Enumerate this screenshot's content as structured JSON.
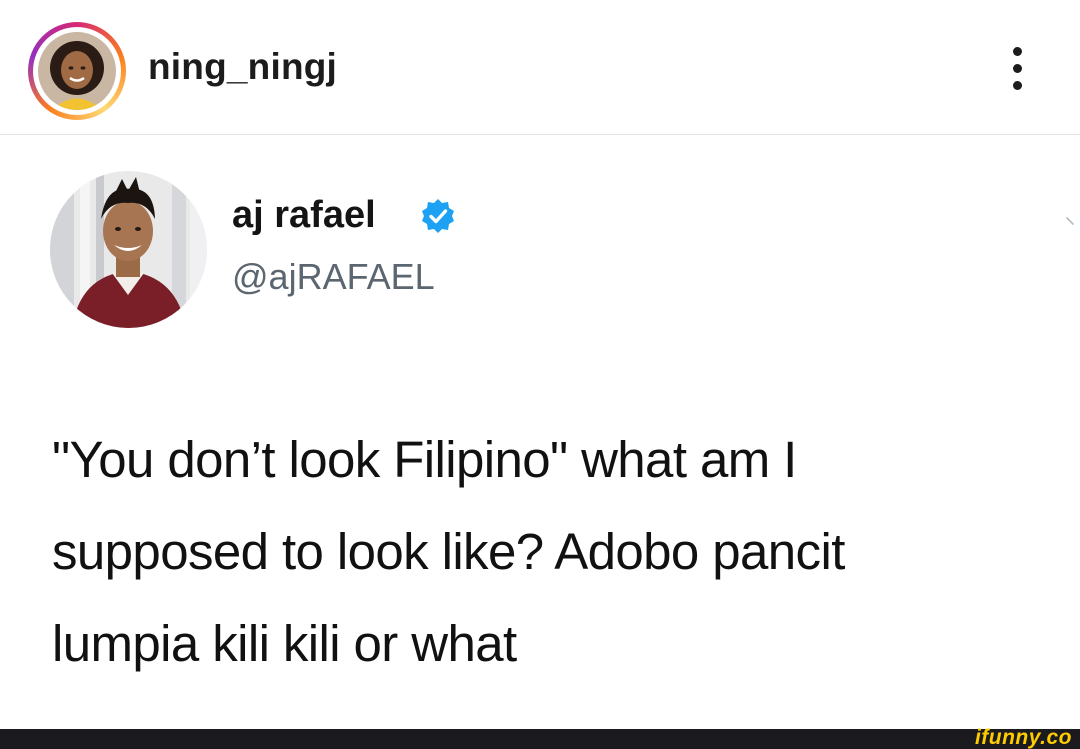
{
  "post_header": {
    "username": "ning_ningj",
    "more_icon": "more-vertical-icon"
  },
  "tweet": {
    "display_name": "aj rafael",
    "verified_icon": "verified-badge-icon",
    "handle": "@ajRAFAEL",
    "text_lines": [
      "\"You don’t look Filipino\" what am I",
      "supposed to look like? Adobo pancit",
      "lumpia kili kili or what"
    ]
  },
  "watermark": {
    "text": "ifunny.co"
  },
  "colors": {
    "verified_blue": "#1da1f2",
    "handle_gray": "#5b6670",
    "ifunny_yellow": "#ffcc00",
    "footer_bg": "#1b1b1f"
  }
}
